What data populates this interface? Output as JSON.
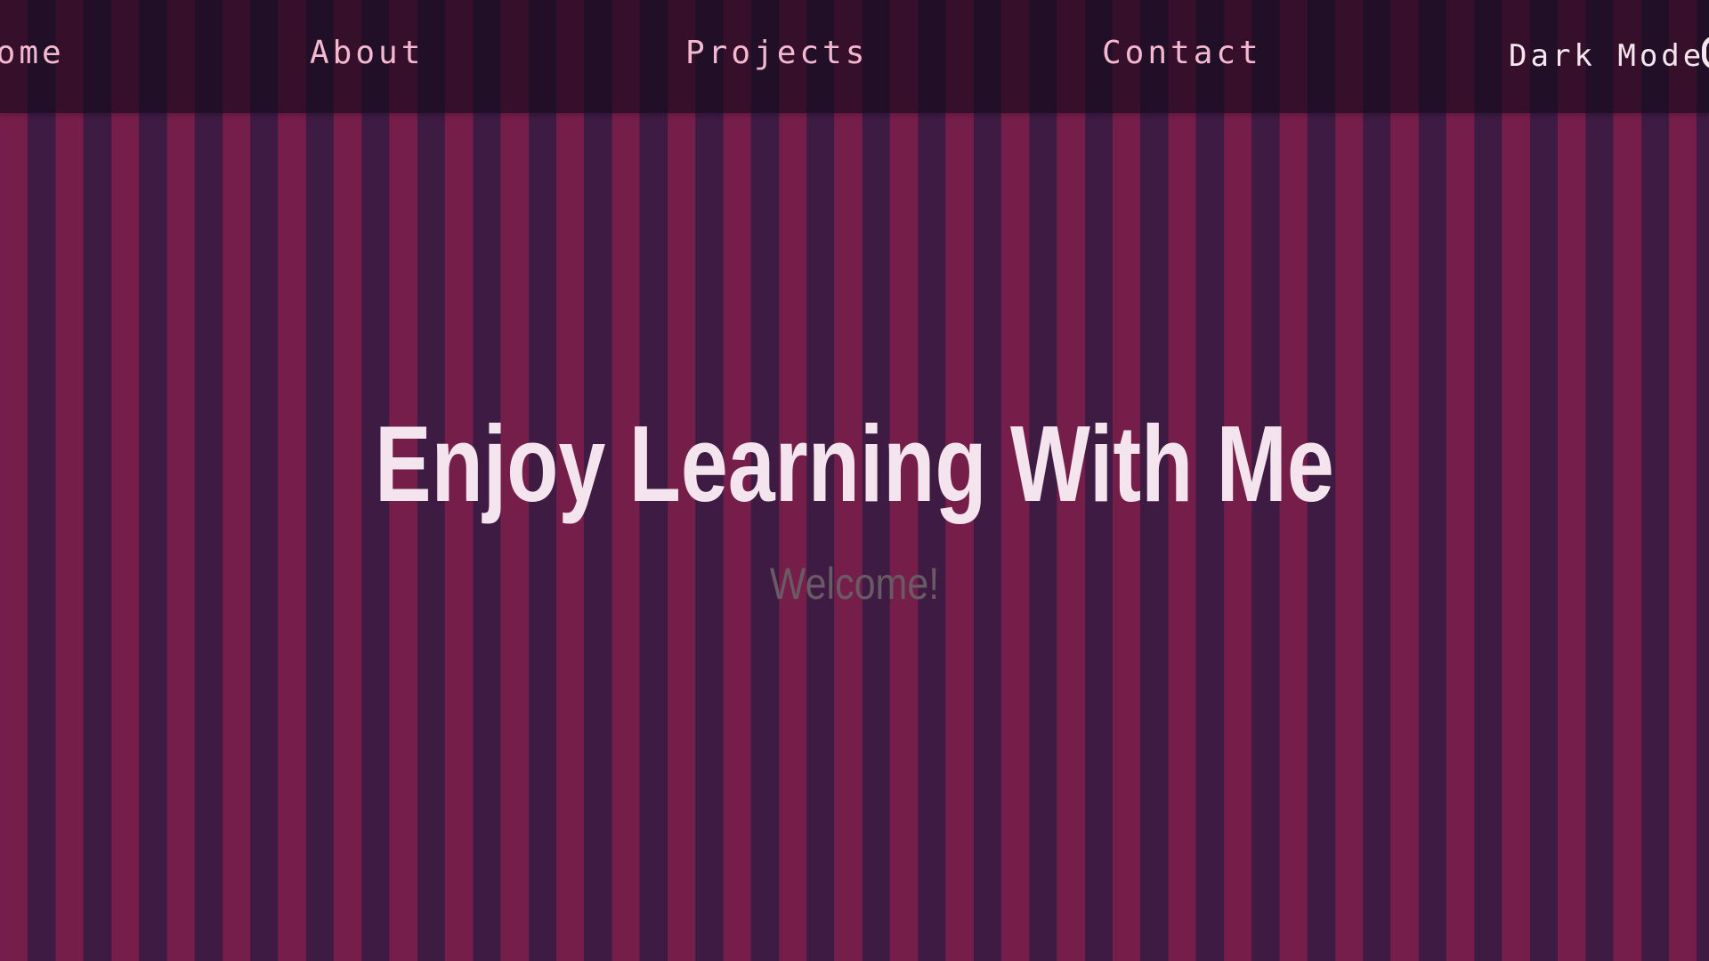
{
  "nav": {
    "items": [
      {
        "label": "Home"
      },
      {
        "label": "About"
      },
      {
        "label": "Projects"
      },
      {
        "label": "Contact"
      }
    ],
    "dark_mode_label": "Dark Mode"
  },
  "hero": {
    "title": "Enjoy Learning With Me",
    "subtitle": "Welcome!"
  },
  "colors": {
    "stripe_light": "#761e4a",
    "stripe_dark": "#3e1b43",
    "nav_link": "#f4b9d0",
    "title": "#f3e4ee",
    "subtitle": "#6a5a66"
  },
  "icons": {
    "toggle": "toggle-switch-icon"
  }
}
